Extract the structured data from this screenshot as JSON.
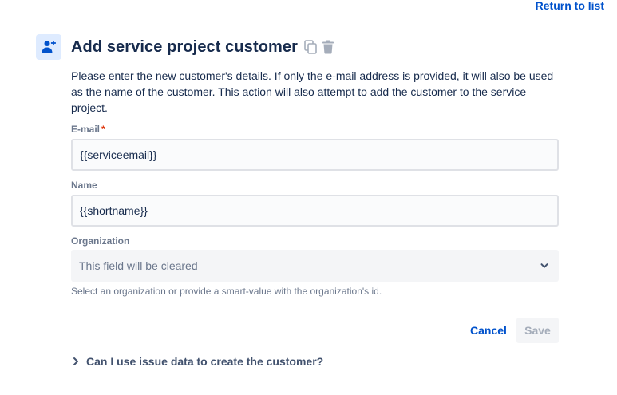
{
  "header": {
    "return_link": "Return to list",
    "title": "Add service project customer",
    "icons": {
      "customer": "add-person-icon",
      "copy": "copy-icon",
      "delete": "trash-icon"
    }
  },
  "description": "Please enter the new customer's details. If only the e-mail address is provided, it will also be used as the name of the customer. This action will also attempt to add the customer to the service project.",
  "fields": {
    "email": {
      "label": "E-mail",
      "required_mark": "*",
      "value": "{{serviceemail}}"
    },
    "name": {
      "label": "Name",
      "value": "{{shortname}}"
    },
    "organization": {
      "label": "Organization",
      "placeholder": "This field will be cleared",
      "helper": "Select an organization or provide a smart-value with the organization's id."
    }
  },
  "actions": {
    "cancel": "Cancel",
    "save": "Save"
  },
  "faq": {
    "label": "Can I use issue data to create the customer?"
  },
  "colors": {
    "link": "#0052cc",
    "icon_bg": "#deebff",
    "required": "#de350b",
    "muted": "#6b778c"
  }
}
